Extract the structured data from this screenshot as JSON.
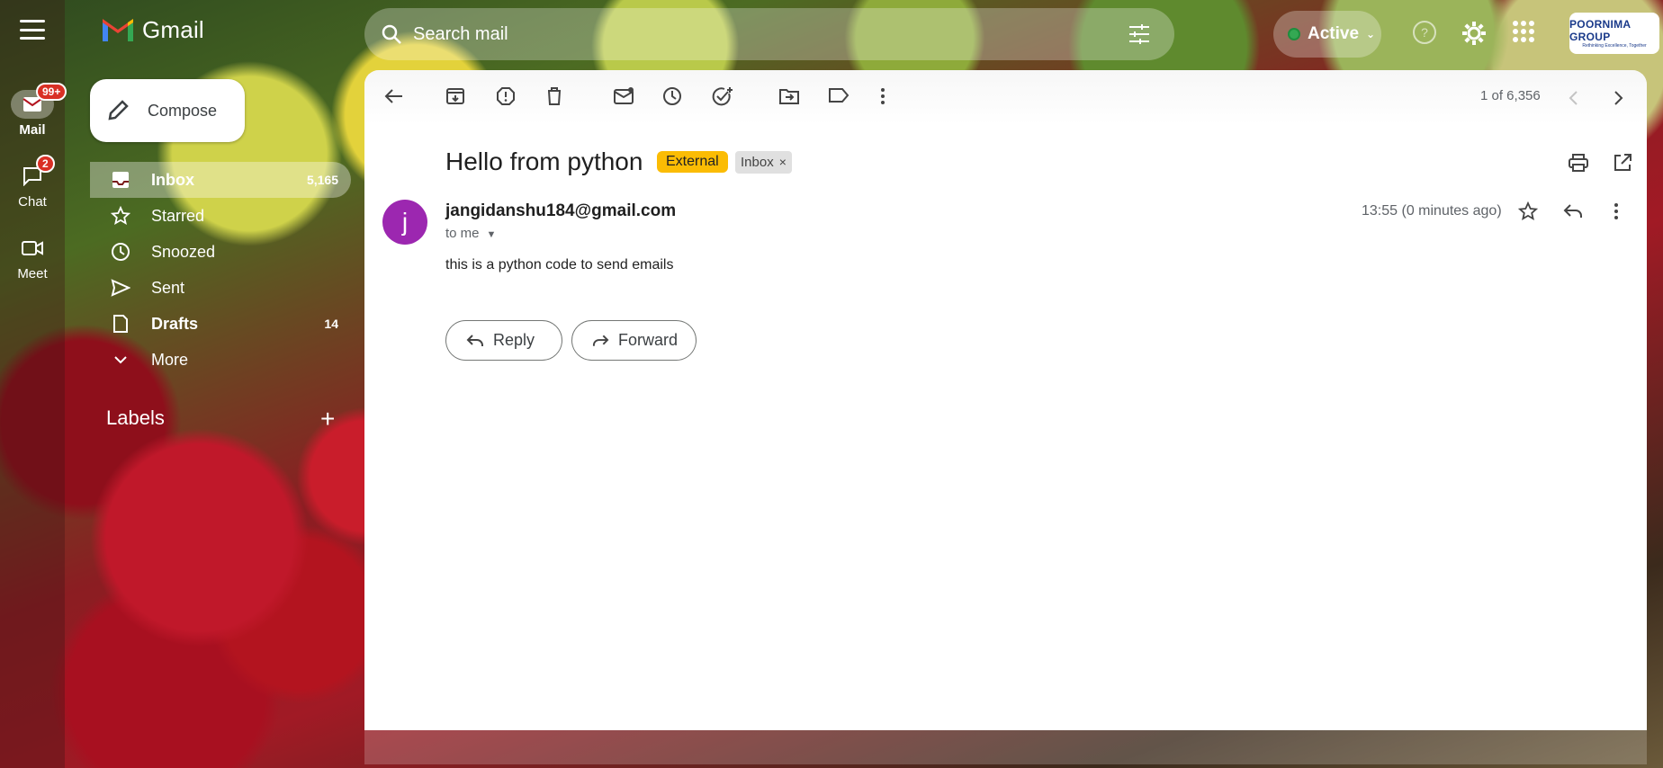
{
  "app": {
    "name": "Gmail"
  },
  "rail": {
    "items": [
      {
        "label": "Mail",
        "badge": "99+",
        "icon": "mail-icon",
        "active": true
      },
      {
        "label": "Chat",
        "badge": "2",
        "icon": "chat-icon",
        "active": false
      },
      {
        "label": "Meet",
        "badge": "",
        "icon": "video-icon",
        "active": false
      }
    ]
  },
  "search": {
    "placeholder": "Search mail"
  },
  "status": {
    "label": "Active",
    "color": "#34a853"
  },
  "org_logo": {
    "title": "POORNIMA GROUP",
    "tagline": "Rethinking Excellence, Together"
  },
  "compose": {
    "label": "Compose"
  },
  "nav": {
    "items": [
      {
        "label": "Inbox",
        "count": "5,165",
        "icon": "inbox-icon"
      },
      {
        "label": "Starred",
        "count": "",
        "icon": "star-icon"
      },
      {
        "label": "Snoozed",
        "count": "",
        "icon": "clock-icon"
      },
      {
        "label": "Sent",
        "count": "",
        "icon": "send-icon"
      },
      {
        "label": "Drafts",
        "count": "14",
        "icon": "draft-icon"
      },
      {
        "label": "More",
        "count": "",
        "icon": "chevron-down-icon"
      }
    ],
    "labels_heading": "Labels"
  },
  "toolbar": {
    "pager": "1 of 6,356"
  },
  "email": {
    "subject": "Hello from python",
    "chips": {
      "external": "External",
      "inbox": "Inbox"
    },
    "avatar_letter": "j",
    "sender": "jangidanshu184@gmail.com",
    "to": "to me",
    "timestamp": "13:55 (0 minutes ago)",
    "body": "this is a python code to send emails"
  },
  "actions": {
    "reply": "Reply",
    "forward": "Forward"
  },
  "colors": {
    "accent": "#fbbc04",
    "avatar": "#9c27b0",
    "badge": "#d93025"
  }
}
